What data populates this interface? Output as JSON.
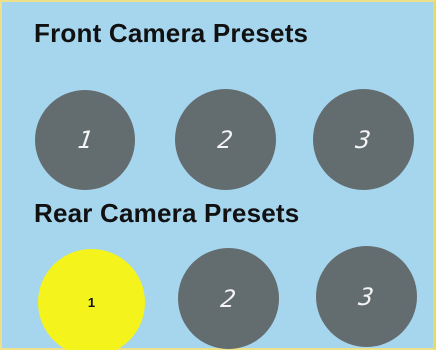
{
  "front": {
    "title": "Front Camera Presets",
    "presets": [
      {
        "label": "1",
        "active": false
      },
      {
        "label": "2",
        "active": false
      },
      {
        "label": "3",
        "active": false
      }
    ]
  },
  "rear": {
    "title": "Rear Camera Presets",
    "presets": [
      {
        "label": "1",
        "active": true
      },
      {
        "label": "2",
        "active": false
      },
      {
        "label": "3",
        "active": false
      }
    ]
  },
  "colors": {
    "background": "#a6d5ee",
    "button_idle": "#636c6e",
    "button_active": "#f4f41c",
    "border": "#ece08a"
  }
}
